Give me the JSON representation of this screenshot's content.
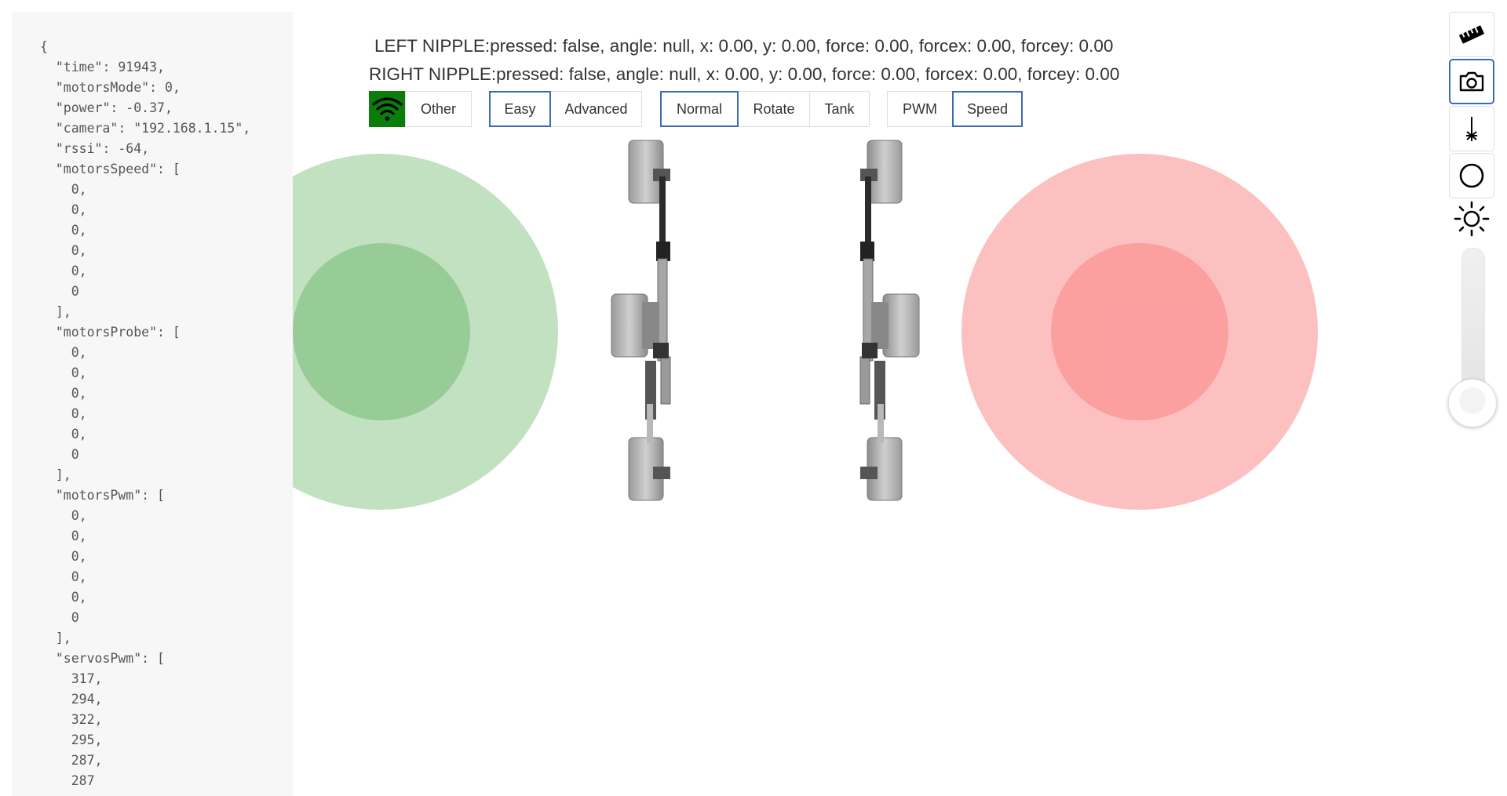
{
  "telemetry_json": "{\n  \"time\": 91943,\n  \"motorsMode\": 0,\n  \"power\": -0.37,\n  \"camera\": \"192.168.1.15\",\n  \"rssi\": -64,\n  \"motorsSpeed\": [\n    0,\n    0,\n    0,\n    0,\n    0,\n    0\n  ],\n  \"motorsProbe\": [\n    0,\n    0,\n    0,\n    0,\n    0,\n    0\n  ],\n  \"motorsPwm\": [\n    0,\n    0,\n    0,\n    0,\n    0,\n    0\n  ],\n  \"servosPwm\": [\n    317,\n    294,\n    322,\n    295,\n    287,\n    287",
  "nipples": {
    "left": "LEFT NIPPLE:pressed: false, angle: null, x: 0.00, y: 0.00, force: 0.00, forcex: 0.00, forcey: 0.00",
    "right": "RIGHT NIPPLE:pressed: false, angle: null, x: 0.00, y: 0.00, force: 0.00, forcex: 0.00, forcey: 0.00"
  },
  "wifi": {
    "icon": "wifi-icon",
    "status_color": "#0a7d0a"
  },
  "groups": {
    "other": {
      "label": "Other"
    },
    "level": {
      "easy": "Easy",
      "advanced": "Advanced",
      "selected": "Easy"
    },
    "steering": {
      "normal": "Normal",
      "rotate": "Rotate",
      "tank": "Tank",
      "selected": "Normal"
    },
    "control": {
      "pwm": "PWM",
      "speed": "Speed",
      "selected": "Speed"
    }
  },
  "joysticks": {
    "left_color": "#64b464",
    "right_color": "#fa8282"
  },
  "toolbar": {
    "tools": [
      "ruler-icon",
      "camera-icon",
      "laser-icon",
      "circle-icon"
    ],
    "active": "camera-icon",
    "brightness_icon": "sun-icon",
    "brightness_level": 0
  },
  "accent_color": "#3b6bb5"
}
